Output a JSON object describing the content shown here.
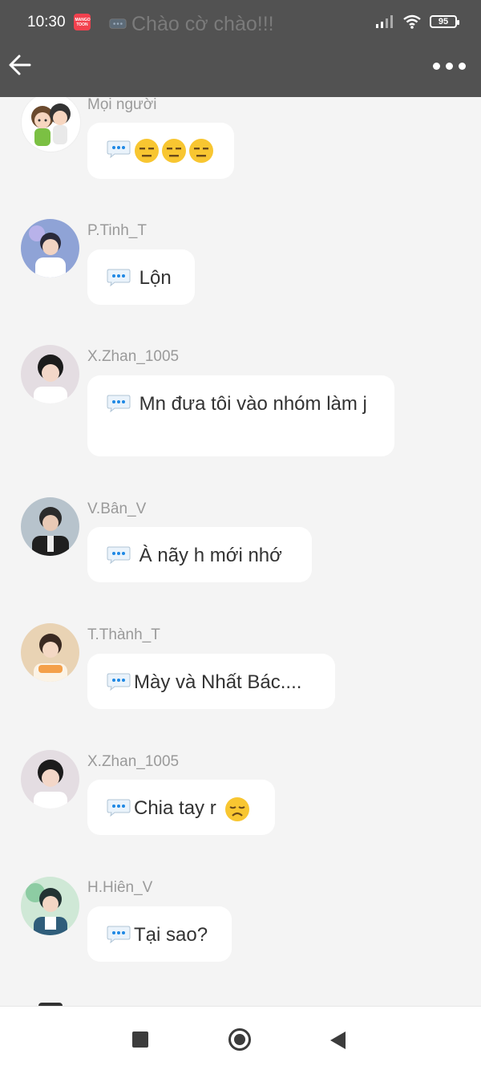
{
  "status_bar": {
    "time": "10:30",
    "app_badge": "MANGO TOON",
    "battery": "95"
  },
  "header": {
    "title": "Chào cờ chào!!!"
  },
  "messages": [
    {
      "sender": "Mọi người",
      "text": "",
      "emoji": [
        "expressionless-face",
        "expressionless-face",
        "expressionless-face"
      ]
    },
    {
      "sender": "P.Tinh_T",
      "text": " Lộn"
    },
    {
      "sender": "X.Zhan_1005",
      "text": " Mn đưa tôi vào nhóm làm j"
    },
    {
      "sender": "V.Bân_V",
      "text": " À nãy h mới nhớ"
    },
    {
      "sender": "T.Thành_T",
      "text": "Mày và Nhất Bác...."
    },
    {
      "sender": "X.Zhan_1005",
      "text": "Chia tay r",
      "emoji": [
        "disappointed-face"
      ]
    },
    {
      "sender": "H.Hiên_V",
      "text": "Tại sao?"
    }
  ],
  "colors": {
    "header_bg": "#525252",
    "page_bg": "#f4f4f4",
    "bubble_bg": "#ffffff",
    "sender": "#9a9a9a",
    "bubble_icon": "#1e88e5"
  },
  "icons": {
    "back": "arrow-left-icon",
    "more": "more-dots-icon",
    "bubble": "speech-bubble-icon",
    "nav_recent": "square-icon",
    "nav_home": "circle-icon",
    "nav_back": "triangle-back-icon"
  }
}
